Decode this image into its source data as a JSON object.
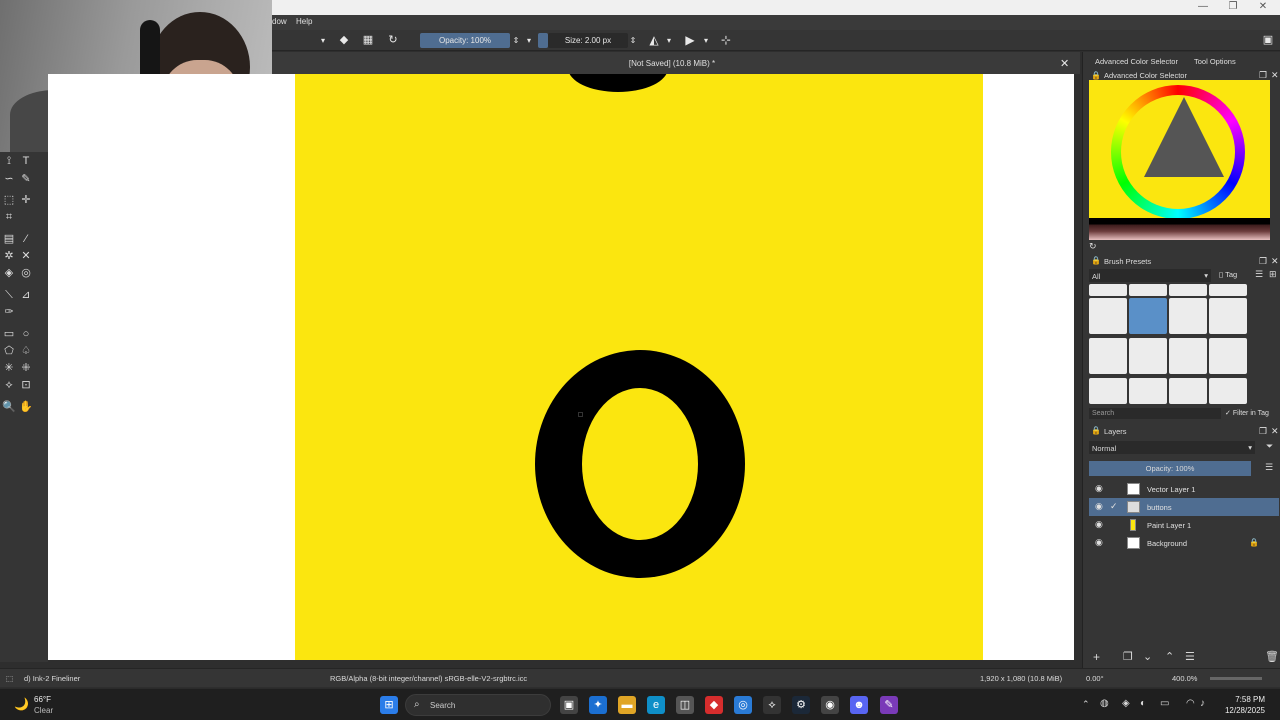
{
  "menubar": {
    "item_window": "dow",
    "item_help": "Help"
  },
  "toolbar": {
    "opacity": "Opacity: 100%",
    "size": "Size: 2.00 px"
  },
  "document": {
    "title": "[Not Saved]  (10.8 MiB) *"
  },
  "dockers": {
    "tab_color": "Advanced Color Selector",
    "tab_tool_options": "Tool Options",
    "color_panel_title": "Advanced Color Selector",
    "brush_panel_title": "Brush Presets",
    "brush_filter_all": "All",
    "brush_tag": "Tag",
    "brush_search_placeholder": "Search",
    "brush_filter_in_tag": "Filter in Tag",
    "layers_title": "Layers",
    "blend_mode": "Normal",
    "layers_opacity": "Opacity:  100%",
    "layers": [
      {
        "name": "Vector Layer 1"
      },
      {
        "name": "buttons"
      },
      {
        "name": "Paint Layer 1"
      },
      {
        "name": "Background"
      }
    ]
  },
  "statusbar": {
    "brush_name": "d) Ink-2 Fineliner",
    "color_profile": "RGB/Alpha (8-bit integer/channel)  sRGB-elle-V2-srgbtrc.icc",
    "image_size": "1,920 x 1,080 (10.8 MiB)",
    "rotation": "0.00°",
    "zoom": "400.0%"
  },
  "taskbar": {
    "weather_temp": "66°F",
    "weather_cond": "Clear",
    "search_placeholder": "Search",
    "time": "7:58 PM",
    "date": "12/28/2025"
  },
  "colors": {
    "canvas_yellow": "#fbe60f",
    "selection_blue": "#4f6d91",
    "panel_bg": "#353535"
  }
}
